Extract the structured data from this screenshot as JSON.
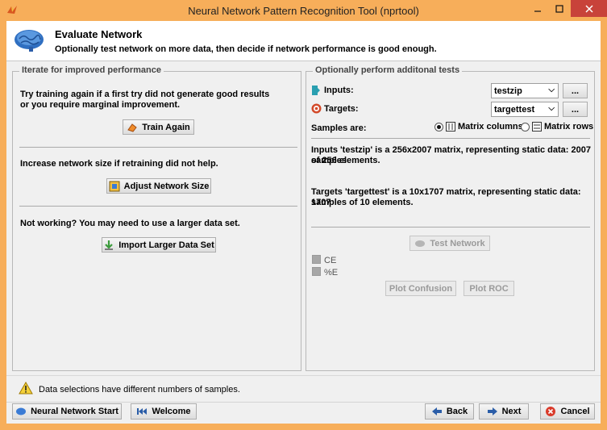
{
  "window": {
    "title": "Neural Network Pattern Recognition Tool (nprtool)"
  },
  "header": {
    "title": "Evaluate Network",
    "subtitle": "Optionally test network on more data, then decide if network performance is good enough."
  },
  "left_panel": {
    "title": "Iterate for improved performance",
    "retrain_text_1": "Try training again if a first try did not generate good results",
    "retrain_text_2": "or you require marginal improvement.",
    "train_again_label": "Train Again",
    "size_text": "Increase network size if retraining did not help.",
    "adjust_label": "Adjust Network Size",
    "data_text": "Not working? You may need to use a larger data set.",
    "import_label": "Import Larger Data Set"
  },
  "right_panel": {
    "title": "Optionally perform additonal tests",
    "inputs_label": "Inputs:",
    "inputs_value": "testzip",
    "targets_label": "Targets:",
    "targets_value": "targettest",
    "browse_label": "...",
    "samples_label": "Samples are:",
    "matrix_columns_label": "Matrix columns",
    "matrix_rows_label": "Matrix rows",
    "inputs_info_1": "Inputs 'testzip' is a 256x2007 matrix, representing static data: 2007 samples",
    "inputs_info_2": "of 256 elements.",
    "targets_info_1": "Targets 'targettest' is a 10x1707 matrix, representing static data: 1707",
    "targets_info_2": "samples of 10 elements.",
    "test_network_label": "Test Network",
    "ce_label": "CE",
    "pe_label": "%E",
    "plot_confusion_label": "Plot Confusion",
    "plot_roc_label": "Plot ROC"
  },
  "warning": {
    "text": "Data selections have different numbers of samples."
  },
  "footer": {
    "start_label": "Neural Network Start",
    "welcome_label": "Welcome",
    "back_label": "Back",
    "next_label": "Next",
    "cancel_label": "Cancel"
  },
  "colors": {
    "frame": "#f7ae5a",
    "close": "#c8423a",
    "panel_bg": "#f0f0f0"
  }
}
